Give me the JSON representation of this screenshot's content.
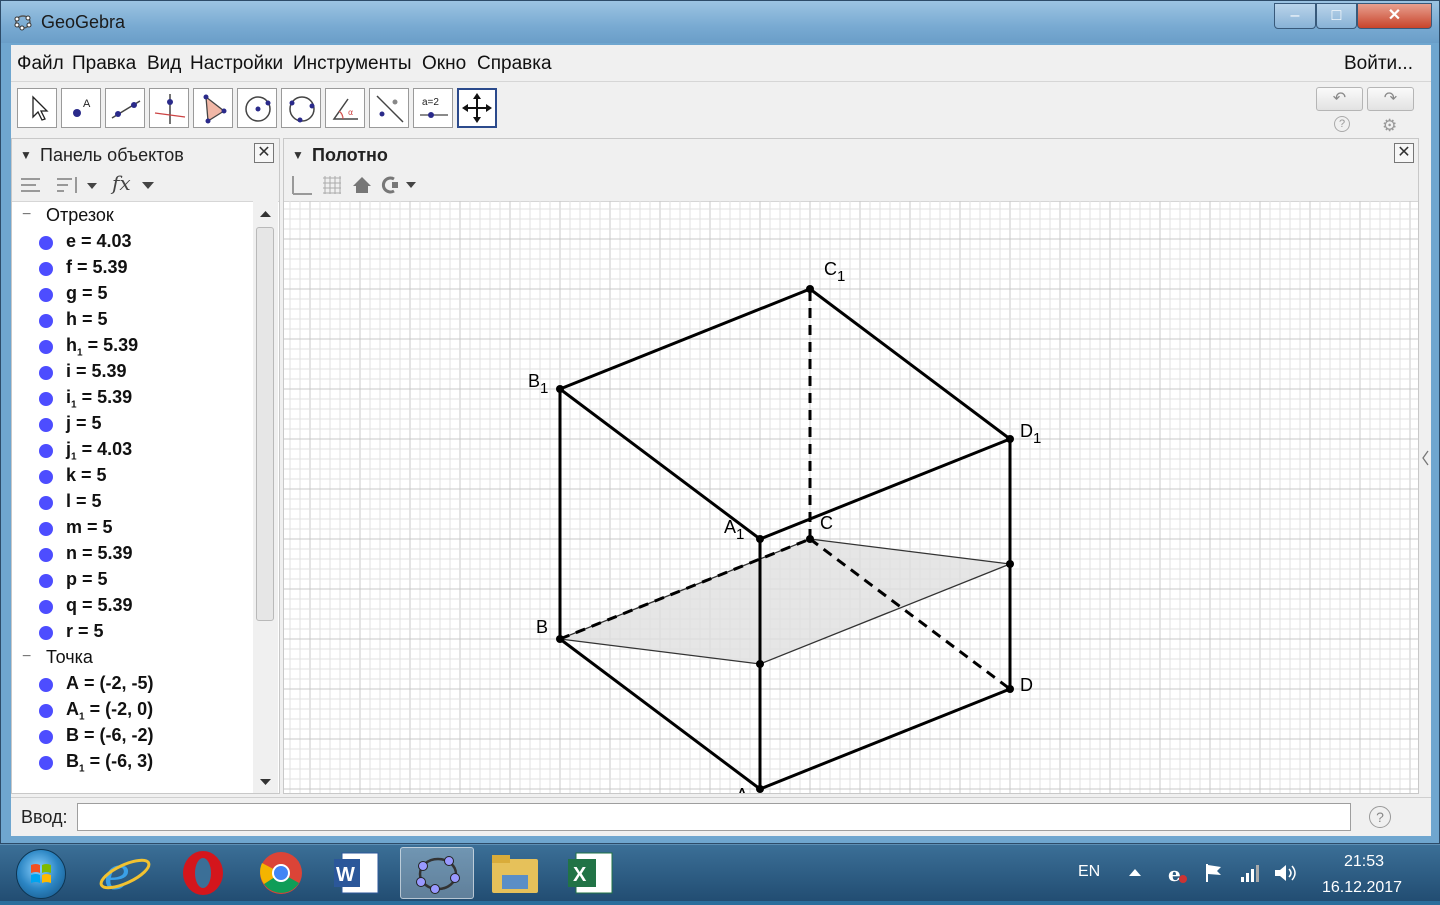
{
  "window": {
    "title": "GeoGebra",
    "controls": {
      "minimize": "‒",
      "maximize": "□",
      "close": "✕"
    }
  },
  "menu": {
    "items": [
      "Файл",
      "Правка",
      "Вид",
      "Настройки",
      "Инструменты",
      "Окно",
      "Справка"
    ],
    "login": "Войти..."
  },
  "toolbar": {
    "tools": [
      "move-tool",
      "point-tool",
      "line-tool",
      "perpendicular-line-tool",
      "polygon-tool",
      "circle-tool",
      "conic-tool",
      "angle-tool",
      "reflect-tool",
      "slider-tool",
      "move-graphics-view-tool"
    ],
    "slider_label": "a=2",
    "undo": "↶",
    "redo": "↷",
    "help": "?",
    "settings": "⚙"
  },
  "algebra": {
    "title": "Панель объектов",
    "fx": "fx",
    "groups": [
      {
        "label": "Отрезок",
        "items": [
          {
            "name": "e",
            "sub": "",
            "value": "= 4.03"
          },
          {
            "name": "f",
            "sub": "",
            "value": "= 5.39"
          },
          {
            "name": "g",
            "sub": "",
            "value": "= 5"
          },
          {
            "name": "h",
            "sub": "",
            "value": "= 5"
          },
          {
            "name": "h",
            "sub": "1",
            "value": "= 5.39"
          },
          {
            "name": "i",
            "sub": "",
            "value": "= 5.39"
          },
          {
            "name": "i",
            "sub": "1",
            "value": "= 5.39"
          },
          {
            "name": "j",
            "sub": "",
            "value": "= 5"
          },
          {
            "name": "j",
            "sub": "1",
            "value": "= 4.03"
          },
          {
            "name": "k",
            "sub": "",
            "value": "= 5"
          },
          {
            "name": "l",
            "sub": "",
            "value": "= 5"
          },
          {
            "name": "m",
            "sub": "",
            "value": "= 5"
          },
          {
            "name": "n",
            "sub": "",
            "value": "= 5.39"
          },
          {
            "name": "p",
            "sub": "",
            "value": "= 5"
          },
          {
            "name": "q",
            "sub": "",
            "value": "= 5.39"
          },
          {
            "name": "r",
            "sub": "",
            "value": "= 5"
          }
        ]
      },
      {
        "label": "Точка",
        "items": [
          {
            "name": "A",
            "sub": "",
            "value": "= (-2, -5)"
          },
          {
            "name": "A",
            "sub": "1",
            "value": "= (-2, 0)"
          },
          {
            "name": "B",
            "sub": "",
            "value": "= (-6, -2)"
          },
          {
            "name": "B",
            "sub": "1",
            "value": "= (-6, 3)"
          }
        ]
      }
    ]
  },
  "graphics": {
    "title": "Полотно",
    "points": [
      {
        "label": "A",
        "sub": "",
        "x": -2,
        "y": -5
      },
      {
        "label": "A",
        "sub": "1",
        "x": -2,
        "y": 0
      },
      {
        "label": "B",
        "sub": "",
        "x": -6,
        "y": -2
      },
      {
        "label": "B",
        "sub": "1",
        "x": -6,
        "y": 3
      },
      {
        "label": "C",
        "sub": "",
        "x": -1,
        "y": 0
      },
      {
        "label": "C",
        "sub": "1",
        "x": -1,
        "y": 5
      },
      {
        "label": "D",
        "sub": "",
        "x": 3,
        "y": -3
      },
      {
        "label": "D",
        "sub": "1",
        "x": 3,
        "y": 2
      },
      {
        "label": "",
        "sub": "",
        "x": -2,
        "y": -2.5
      },
      {
        "label": "",
        "sub": "",
        "x": 3,
        "y": -0.5
      }
    ]
  },
  "input_bar": {
    "label": "Ввод:",
    "value": "",
    "help": "?"
  },
  "taskbar": {
    "apps": [
      "internet-explorer",
      "opera",
      "chrome",
      "word",
      "geogebra",
      "file-explorer",
      "excel"
    ],
    "language": "EN",
    "time": "21:53",
    "date": "16.12.2017"
  },
  "colors": {
    "point_blue": "#4d4dff",
    "polygon_fill": "#e0e0e0",
    "grid": "#e2e2e2",
    "selected_tool_border": "#2b4a8c"
  }
}
